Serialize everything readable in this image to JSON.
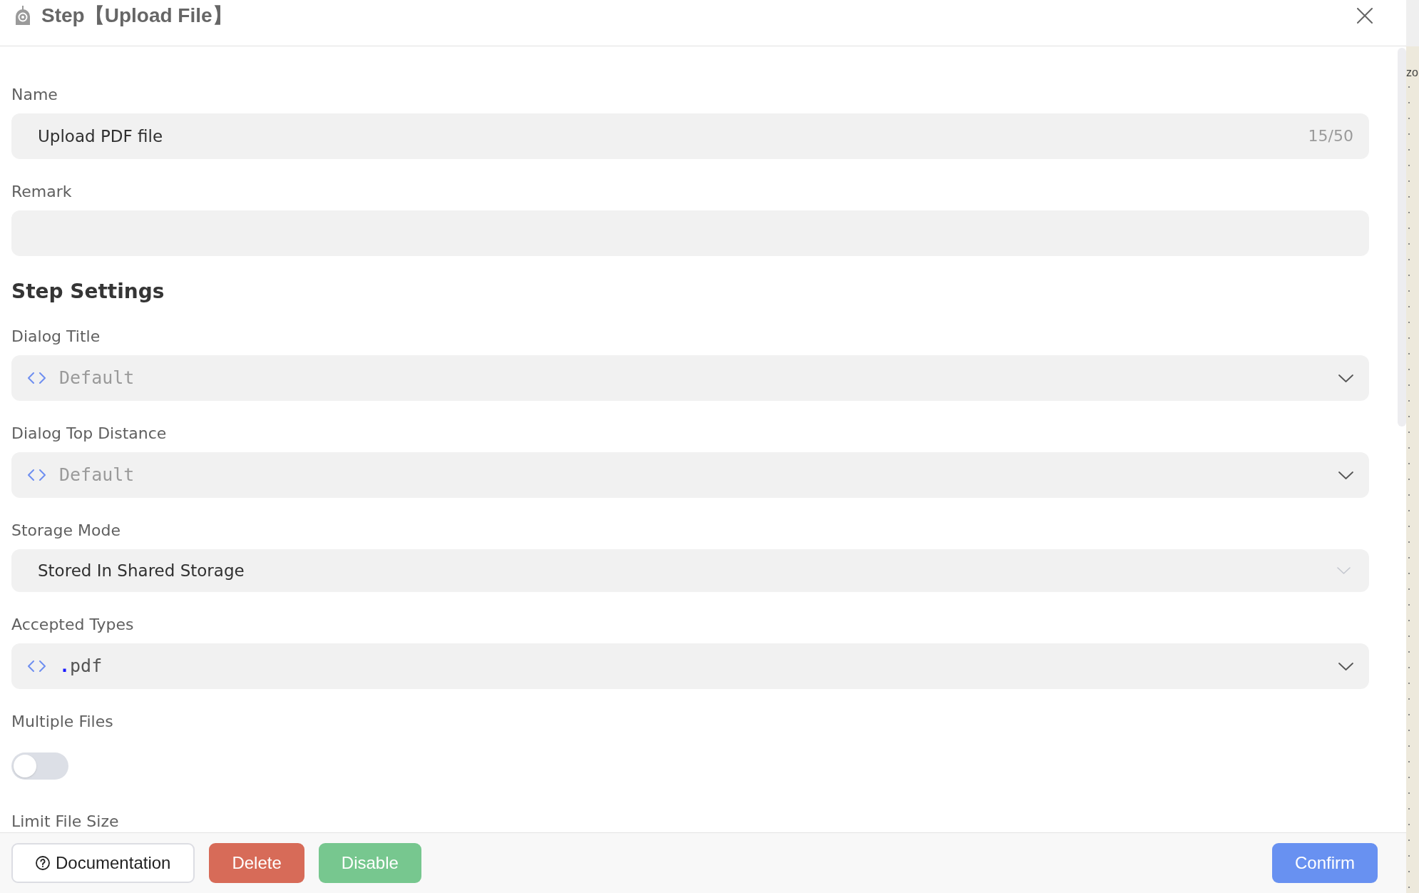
{
  "dialog": {
    "title": "Step【Upload File】"
  },
  "fields": [
    {
      "kind": "text",
      "label": "Name",
      "value": "Upload PDF file",
      "counter": "15/50"
    },
    {
      "kind": "text",
      "label": "Remark"
    }
  ],
  "step_settings": {
    "heading": "Step Settings",
    "fields": [
      {
        "kind": "expression",
        "label": "Dialog Title",
        "placeholder": "Default"
      },
      {
        "kind": "expression",
        "label": "Dialog Top Distance",
        "placeholder": "Default"
      },
      {
        "kind": "select",
        "label": "Storage Mode",
        "value": "Stored In Shared Storage"
      },
      {
        "kind": "expression",
        "label": "Accepted Types",
        "tokens": [
          {
            "kind": "punctuation",
            "text": "."
          },
          {
            "kind": "identifier",
            "text": "pdf"
          }
        ]
      },
      {
        "kind": "switch",
        "label": "Multiple Files",
        "on": false
      },
      {
        "kind": "label",
        "label": "Limit File Size"
      }
    ]
  },
  "footer": {
    "left_buttons": [
      {
        "kind": "help",
        "label": "Documentation"
      },
      {
        "kind": "danger",
        "label": "Delete"
      },
      {
        "kind": "success",
        "label": "Disable"
      }
    ],
    "right_buttons": [
      {
        "kind": "primary",
        "label": "Confirm"
      }
    ]
  },
  "backdrop": {
    "text": "zo"
  }
}
